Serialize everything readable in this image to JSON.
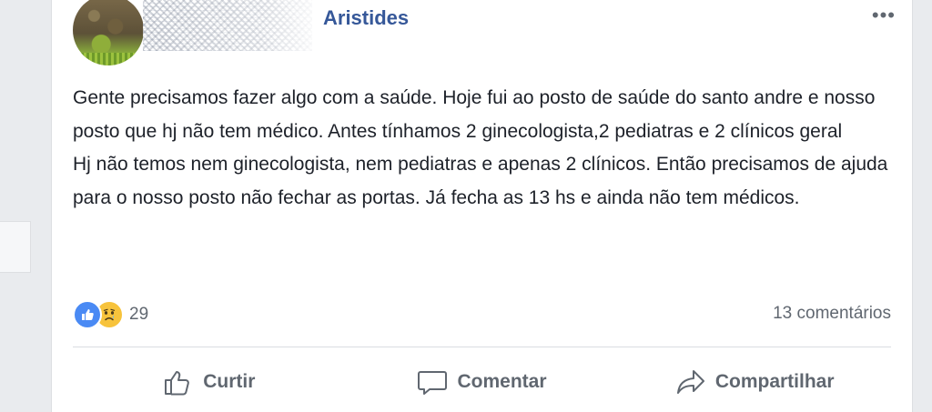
{
  "post": {
    "author": "Aristides",
    "more_icon": "•••",
    "body": [
      "Gente precisamos fazer algo com a saúde. Hoje fui ao posto de saúde do santo andre e nosso posto que hj não tem médico. Antes tínhamos 2 ginecologista,2 pediatras e 2 clínicos geral",
      "Hj não temos nem ginecologista, nem pediatras e apenas 2 clínicos. Então precisamos de ajuda para o nosso posto não fechar as portas. Já fecha as 13 hs e ainda não tem médicos."
    ]
  },
  "reactions": {
    "icons": [
      "like-icon",
      "sad-icon"
    ],
    "count": "29"
  },
  "comments": {
    "label": "13 comentários"
  },
  "actions": {
    "like": "Curtir",
    "comment": "Comentar",
    "share": "Compartilhar"
  },
  "colors": {
    "author_link": "#365899",
    "text": "#1d2129",
    "secondary_text": "#606770",
    "like_blue": "#4a8af4",
    "sad_yellow": "#f7c33c"
  }
}
